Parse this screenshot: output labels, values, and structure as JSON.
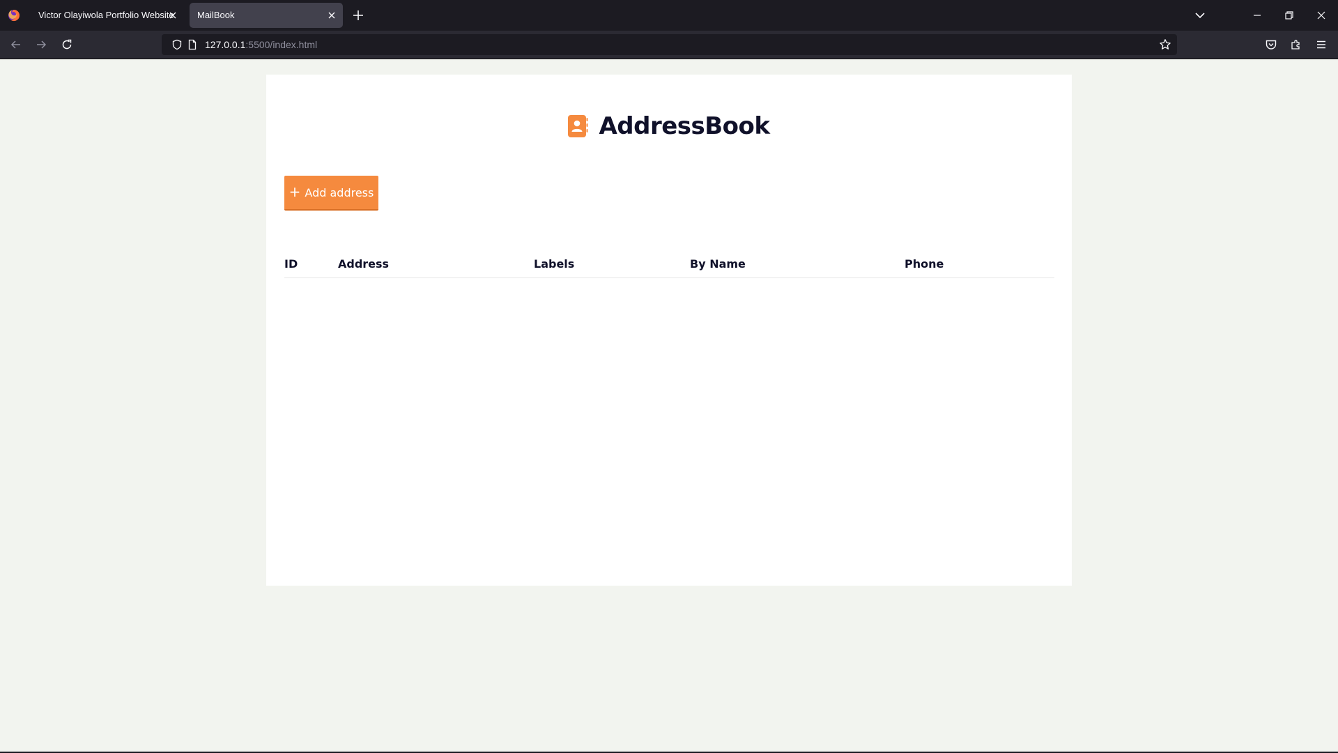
{
  "browser": {
    "tabs": [
      {
        "title": "Victor Olayiwola Portfolio Website",
        "active": false
      },
      {
        "title": "MailBook",
        "active": true
      }
    ],
    "url": {
      "host": "127.0.0.1",
      "rest": ":5500/index.html"
    },
    "icons": {
      "logo": "firefox-logo-icon",
      "new_tab": "plus-icon",
      "tab_list": "chevron-down-icon",
      "back": "back-arrow-icon",
      "forward": "forward-arrow-icon",
      "reload": "reload-icon",
      "shield": "shield-icon",
      "page": "page-icon",
      "bookmark": "star-icon",
      "pocket": "pocket-icon",
      "extensions": "puzzle-icon",
      "menu": "hamburger-menu-icon"
    }
  },
  "app": {
    "title": "AddressBook",
    "brand_icon": "contact-book-icon",
    "add_button": {
      "plus": "+",
      "label": "Add address"
    },
    "table": {
      "columns": [
        "ID",
        "Address",
        "Labels",
        "By Name",
        "Phone"
      ],
      "rows": []
    },
    "colors": {
      "accent": "#f58a3e",
      "title": "#10112a",
      "background": "#f2f4ef"
    }
  }
}
